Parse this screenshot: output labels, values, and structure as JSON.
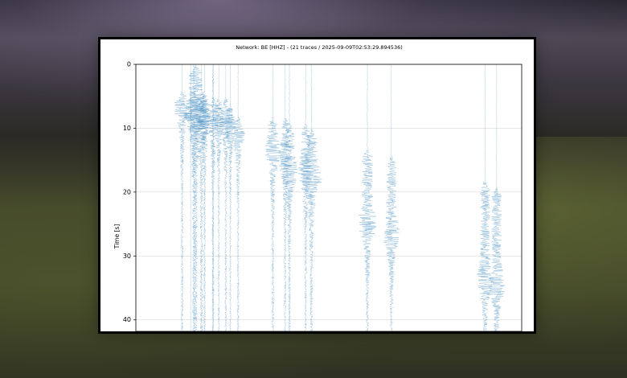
{
  "chart_data": {
    "type": "line",
    "title": "Network: BE [HHZ] - (21 traces / 2025-09-09T02:53:29.894536)",
    "ylabel": "Time [s]",
    "xlabel": "",
    "ylim": [
      0,
      42
    ],
    "y_inverted": true,
    "yticks": [
      0,
      10,
      20,
      30,
      40
    ],
    "ytick_labels": [
      "0",
      "10",
      "20",
      "30",
      "40"
    ],
    "grid": true,
    "trace_color": "#1f77b4",
    "traces": [
      {
        "x": 0.12,
        "onset": 4,
        "amp": 0.02,
        "peak": 7
      },
      {
        "x": 0.15,
        "onset": 4,
        "amp": 0.024,
        "peak": 8
      },
      {
        "x": 0.155,
        "onset": 0,
        "amp": 0.03,
        "peak": 8
      },
      {
        "x": 0.17,
        "onset": 4,
        "amp": 0.024,
        "peak": 9
      },
      {
        "x": 0.178,
        "onset": 4,
        "amp": 0.018,
        "peak": 9
      },
      {
        "x": 0.2,
        "onset": 5,
        "amp": 0.02,
        "peak": 8
      },
      {
        "x": 0.215,
        "onset": 5,
        "amp": 0.016,
        "peak": 9
      },
      {
        "x": 0.233,
        "onset": 5,
        "amp": 0.018,
        "peak": 9
      },
      {
        "x": 0.245,
        "onset": 6,
        "amp": 0.014,
        "peak": 10
      },
      {
        "x": 0.265,
        "onset": 8,
        "amp": 0.018,
        "peak": 11
      },
      {
        "x": 0.355,
        "onset": 8,
        "amp": 0.02,
        "peak": 14
      },
      {
        "x": 0.387,
        "onset": 8,
        "amp": 0.018,
        "peak": 15
      },
      {
        "x": 0.398,
        "onset": 9,
        "amp": 0.022,
        "peak": 17
      },
      {
        "x": 0.44,
        "onset": 9,
        "amp": 0.02,
        "peak": 17
      },
      {
        "x": 0.455,
        "onset": 10,
        "amp": 0.026,
        "peak": 18
      },
      {
        "x": 0.6,
        "onset": 13,
        "amp": 0.024,
        "peak": 25
      },
      {
        "x": 0.662,
        "onset": 14,
        "amp": 0.022,
        "peak": 27
      },
      {
        "x": 0.905,
        "onset": 18,
        "amp": 0.022,
        "peak": 34
      },
      {
        "x": 0.935,
        "onset": 19,
        "amp": 0.022,
        "peak": 35
      },
      {
        "x": 0.142,
        "onset": 0,
        "amp": 0.003,
        "peak": 10
      },
      {
        "x": 0.2,
        "onset": 0,
        "amp": 0.003,
        "peak": 10
      }
    ]
  }
}
